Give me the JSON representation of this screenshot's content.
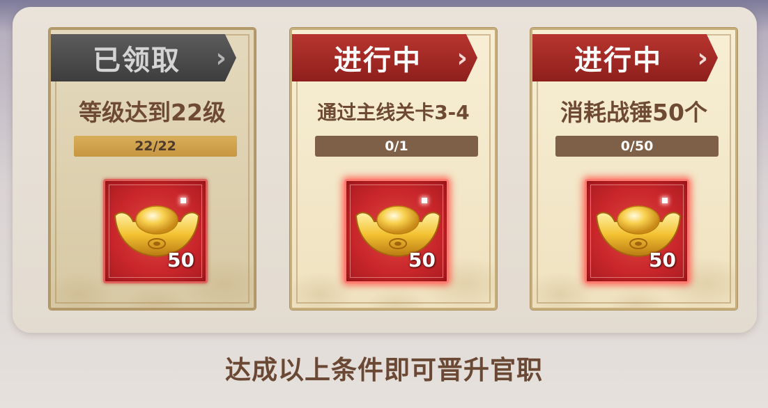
{
  "tasks": [
    {
      "status": "已领取",
      "description": "等级达到22级",
      "progress_text": "22/22",
      "progress_fraction": 1.0,
      "reward_amount": "50",
      "reward_icon": "gold-ingot-icon"
    },
    {
      "status": "进行中",
      "description": "通过主线关卡3-4",
      "progress_text": "0/1",
      "progress_fraction": 0.0,
      "reward_amount": "50",
      "reward_icon": "gold-ingot-icon"
    },
    {
      "status": "进行中",
      "description": "消耗战锤50个",
      "progress_text": "0/50",
      "progress_fraction": 0.0,
      "reward_amount": "50",
      "reward_icon": "gold-ingot-icon"
    }
  ],
  "footer_text": "达成以上条件即可晋升官职",
  "colors": {
    "claimed_ribbon": "#4a4a4a",
    "active_ribbon": "#a52a26",
    "progress_fill": "#d1a350",
    "progress_track": "#7e6048",
    "text_brown": "#6e4a33",
    "reward_red": "#c8262a"
  }
}
